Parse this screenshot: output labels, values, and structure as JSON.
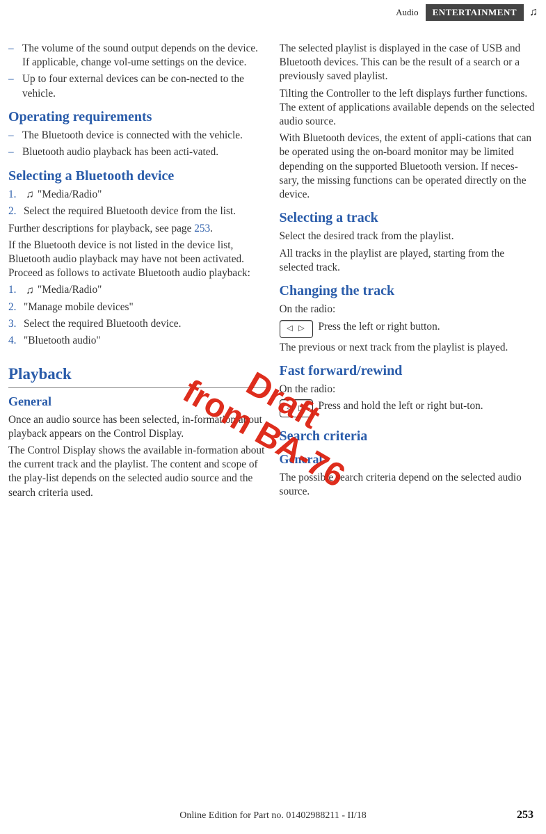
{
  "header": {
    "audio": "Audio",
    "ent": "ENTERTAINMENT"
  },
  "watermark": {
    "line1": "Draft",
    "line2": "from BA-76"
  },
  "left": {
    "b1": "The volume of the sound output depends on the device. If applicable, change vol‐ume settings on the device.",
    "b2": "Up to four external devices can be con‐nected to the vehicle.",
    "h_opreq": "Operating requirements",
    "b3": "The Bluetooth device is connected with the vehicle.",
    "b4": "Bluetooth audio playback has been acti‐vated.",
    "h_selbt": "Selecting a Bluetooth device",
    "o1_a": "\"Media/Radio\"",
    "o2_a": "Select the required Bluetooth device from the list.",
    "p_furth": "Further descriptions for playback, see page ",
    "p_pg": "253",
    "p_furth2": ".",
    "p_notlisted": "If the Bluetooth device is not listed in the device list, Bluetooth audio playback may have not been activated. Proceed as follows to activate Bluetooth audio playback:",
    "o1_b": "\"Media/Radio\"",
    "o2_b": "\"Manage mobile devices\"",
    "o3_b": "Select the required Bluetooth device.",
    "o4_b": "\"Bluetooth audio\"",
    "h_pb": "Playback",
    "h_gen": "General",
    "p_gen1": "Once an audio source has been selected, in‐formation about playback appears on the Control Display.",
    "p_gen2": "The Control Display shows the available in‐formation about the current track and the playlist. The content and scope of the play‐list depends on the selected audio source and the search criteria used."
  },
  "right": {
    "p_r1": "The selected playlist is displayed in the case of USB and Bluetooth devices. This can be the result of a search or a previously saved playlist.",
    "p_r2": "Tilting the Controller to the left displays further functions. The extent of applications available depends on the selected audio source.",
    "p_r3": "With Bluetooth devices, the extent of appli‐cations that can be operated using the on-board monitor may be limited depending on the supported Bluetooth version. If neces‐sary, the missing functions can be operated directly on the device.",
    "h_seltrk": "Selecting a track",
    "p_st1": "Select the desired track from the playlist.",
    "p_st2": "All tracks in the playlist are played, starting from the selected track.",
    "h_chg": "Changing the track",
    "p_onradio1": "On the radio:",
    "p_press1": "Press the left or right button.",
    "p_prevnext": "The previous or next track from the playlist is played.",
    "h_ff": "Fast forward/rewind",
    "p_onradio2": "On the radio:",
    "p_press2": "Press and hold the left or right but‐ton.",
    "h_sc": "Search criteria",
    "h_sc_gen": "General",
    "p_sc": "The possible search criteria depend on the selected audio source."
  },
  "footer": {
    "edition": "Online Edition for Part no. 01402988211 - II/18",
    "pagenum": "253"
  }
}
